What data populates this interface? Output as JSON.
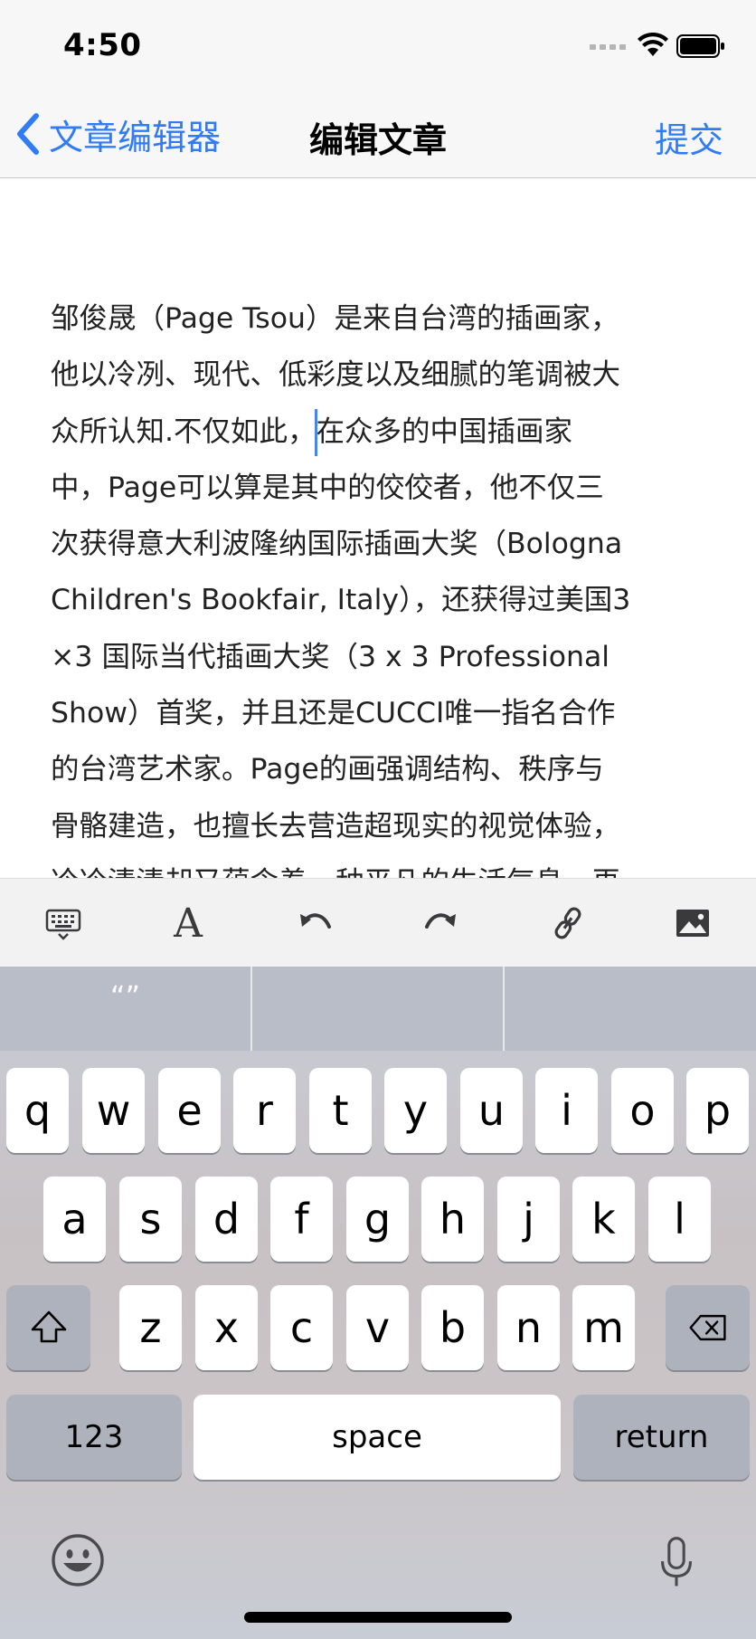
{
  "status_bar": {
    "time": "4:50"
  },
  "nav": {
    "back_label": "文章编辑器",
    "title": "编辑文章",
    "submit_label": "提交"
  },
  "article": {
    "lines": [
      "邹俊晟（Page Tsou）是来自台湾的插画家，",
      "他以冷冽、现代、低彩度以及细腻的笔调被大",
      "众所认知.不仅如此，在众多的中国插画家",
      "中，Page可以算是其中的佼佼者，他不仅三",
      "次获得意大利波隆纳国际插画大奖（Bologna",
      "Children's Bookfair, Italy），还获得过美国3",
      "×3 国际当代插画大奖（3 x 3 Professional",
      "Show）首奖，并且还是CUCCI唯一指名合作",
      "的台湾艺术家。Page的画强调结构、秩序与",
      "骨骼建造，也擅长去营造超现实的视觉体验，",
      "冷冷清清却又蕴含着一种平凡的生活气息，再"
    ]
  },
  "toolbar": {
    "items": [
      "keyboard-dismiss-icon",
      "font-icon",
      "undo-icon",
      "redo-icon",
      "link-icon",
      "image-icon"
    ],
    "font_label": "A"
  },
  "keyboard": {
    "candidates": [
      "“”",
      "",
      ""
    ],
    "row1": [
      "q",
      "w",
      "e",
      "r",
      "t",
      "y",
      "u",
      "i",
      "o",
      "p"
    ],
    "row2": [
      "a",
      "s",
      "d",
      "f",
      "g",
      "h",
      "j",
      "k",
      "l"
    ],
    "row3": [
      "z",
      "x",
      "c",
      "v",
      "b",
      "n",
      "m"
    ],
    "numbers_label": "123",
    "space_label": "space",
    "return_label": "return"
  }
}
